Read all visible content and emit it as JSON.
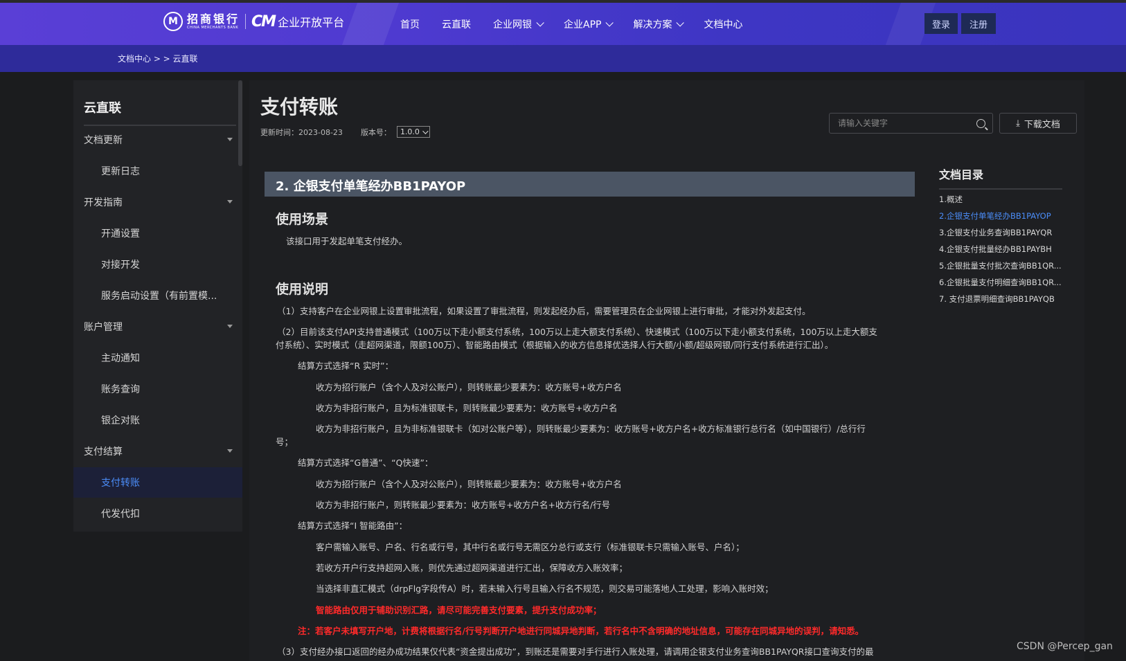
{
  "header": {
    "logo": {
      "seal": "M",
      "bank_cn": "招商银行",
      "bank_en": "CHINA MERCHANTS BANK",
      "cm": "CM",
      "platform": "企业开放平台"
    },
    "nav": [
      {
        "label": "首页",
        "dropdown": false
      },
      {
        "label": "云直联",
        "dropdown": false
      },
      {
        "label": "企业网银",
        "dropdown": true
      },
      {
        "label": "企业APP",
        "dropdown": true
      },
      {
        "label": "解决方案",
        "dropdown": true
      },
      {
        "label": "文档中心",
        "dropdown": false
      }
    ],
    "login": "登录",
    "register": "注册"
  },
  "breadcrumb": "文档中心 > > 云直联",
  "sidebar": {
    "title": "云直联",
    "items": [
      {
        "label": "文档更新",
        "type": "group"
      },
      {
        "label": "更新日志",
        "type": "child"
      },
      {
        "label": "开发指南",
        "type": "group"
      },
      {
        "label": "开通设置",
        "type": "child"
      },
      {
        "label": "对接开发",
        "type": "child"
      },
      {
        "label": "服务启动设置（有前置模...",
        "type": "child"
      },
      {
        "label": "账户管理",
        "type": "group"
      },
      {
        "label": "主动通知",
        "type": "child"
      },
      {
        "label": "账务查询",
        "type": "child"
      },
      {
        "label": "银企对账",
        "type": "child"
      },
      {
        "label": "支付结算",
        "type": "group"
      },
      {
        "label": "支付转账",
        "type": "child",
        "active": true
      },
      {
        "label": "代发代扣",
        "type": "child"
      }
    ]
  },
  "doc": {
    "title": "支付转账",
    "update_label": "更新时间：2023-08-23",
    "version_label": "版本号：",
    "version_value": "1.0.0",
    "search_placeholder": "请输入关键字",
    "download": "下载文档",
    "section": "2. 企银支付单笔经办BB1PAYOP",
    "h_scene": "使用场景",
    "scene_text": "该接口用于发起单笔支付经办。",
    "h_usage": "使用说明",
    "lines": [
      "（1）支持客户在企业网银上设置审批流程，如果设置了审批流程，则发起经办后，需要管理员在企业网银上进行审批，才能对外发起支付。",
      "（2）目前该支付API支持普通模式（100万以下走小额支付系统，100万以上走大额支付系统）、快速模式（100万以下走小额支付系统，100万以上走大额支",
      "付系统）、实时模式（走超网渠道，限额100万）、智能路由模式（根据输入的收方信息择优选择人行大额/小额/超级网银/同行支付系统进行汇出）。",
      "结算方式选择“R 实时”：",
      "收方为招行账户（含个人及对公账户），则转账最少要素为：收方账号+收方户名",
      "收方为非招行账户，且为标准银联卡，则转账最少要素为：收方账号+收方户名",
      "收方为非招行账户，且为非标准银联卡（如对公账户等），则转账最少要素为：收方账号+收方户名+收方标准银行总行名（如中国银行）/总行行",
      "号；",
      "结算方式选择“G普通”、“Q快速”：",
      "收方为招行账户（含个人及对公账户），则转账最少要素为：收方账号+收方户名",
      "收方为非招行账户，则转账最少要素为：收方账号+收方户名+收方行名/行号",
      "结算方式选择“I 智能路由”：",
      "客户需输入账号、户名、行名或行号，其中行名或行号无需区分总行或支行（标准银联卡只需输入账号、户名）；",
      "若收方开户行支持超网入账，则优先通过超网渠道进行汇出，保障收方入账效率；",
      "当选择非直汇模式（drpFlg字段传A）时，若未输入行号且输入行名不规范，则交易可能落地人工处理，影响入账时效；",
      "智能路由仅用于辅助识别汇路，请尽可能完善支付要素，提升支付成功率；",
      "注：若客户未填写开户地，计费将根据行名/行号判断开户地进行同城异地判断，若行名中不含明确的地址信息，可能存在同城异地的误判，请知悉。",
      "（3）支付经办接口返回的经办成功结果仅代表“资金提出成功”，到账还是需要对手行进行入账处理，请调用企银支付业务查询BB1PAYQR接口查询支付的最"
    ]
  },
  "toc": {
    "title": "文档目录",
    "items": [
      {
        "label": "1.概述"
      },
      {
        "label": "2.企银支付单笔经办BB1PAYOP",
        "active": true
      },
      {
        "label": "3.企银支付业务查询BB1PAYQR"
      },
      {
        "label": "4.企银支付批量经办BB1PAYBH"
      },
      {
        "label": "5.企银批量支付批次查询BB1QR..."
      },
      {
        "label": "6.企银批量支付明细查询BB1QR..."
      },
      {
        "label": "7. 支付退票明细查询BB1PAYQB"
      }
    ]
  },
  "watermark": "CSDN @Percep_gan",
  "colors": {
    "accent": "#4b8df8",
    "header": "#4e3ad0",
    "warning": "#ff2a2a"
  }
}
